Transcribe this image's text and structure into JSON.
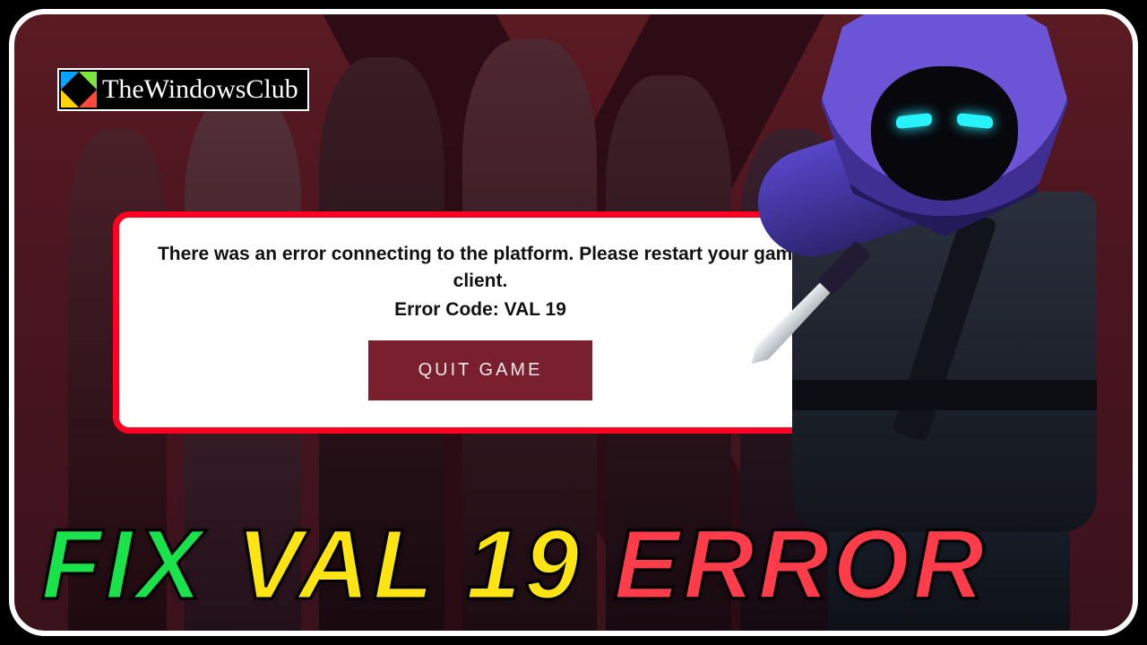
{
  "badge": {
    "text": "TheWindowsClub"
  },
  "dialog": {
    "message": "There was an error connecting to the platform. Please restart your game client.",
    "error_code": "Error Code: VAL 19",
    "quit_label": "QUIT GAME"
  },
  "title": {
    "w1": "FIX",
    "w2": "VAL 19",
    "w3": "ERROR"
  },
  "colors": {
    "dialog_border": "#ff0024",
    "quit_button_bg": "#7a1f2d",
    "title_green": "#19e24a",
    "title_yellow": "#ffe414",
    "title_red": "#ff3d4a",
    "hood_purple": "#6b54d6"
  }
}
